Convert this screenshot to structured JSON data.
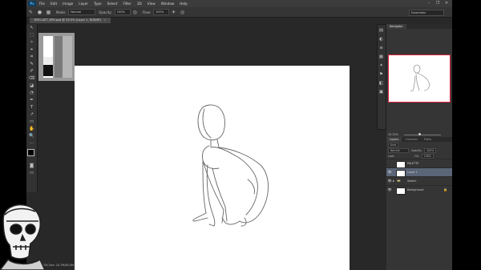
{
  "app": {
    "logo": "Ps",
    "menu": [
      "File",
      "Edit",
      "Image",
      "Layer",
      "Type",
      "Select",
      "Filter",
      "3D",
      "View",
      "Window",
      "Help"
    ],
    "window_controls": {
      "minimize": "–",
      "restore": "❐",
      "close": "✕"
    }
  },
  "options": {
    "mode_label": "Mode:",
    "mode_value": "Normal",
    "opacity_label": "Opacity:",
    "opacity_value": "100%",
    "flow_label": "Flow:",
    "flow_value": "100%",
    "workspace": "Essentials"
  },
  "document": {
    "tab_title": "REF.LAST_4RH.psd @ 33.3% (Layer 1, RGB/8*)",
    "close": "×",
    "status": "33.33%     Doc: 24.7M/48.0M"
  },
  "tools": [
    "↖",
    "⬚",
    "✧",
    "⌖",
    "⌗",
    "✎",
    "✐",
    "⌫",
    "◪",
    "◔",
    "✒",
    "T",
    "↗",
    "▭",
    "✋",
    "🔍",
    "⋯"
  ],
  "dock_icons": [
    "▤",
    "◐",
    "≡",
    "▦",
    "✦",
    "⚑",
    "◧",
    "▣"
  ],
  "panels": {
    "navigator_tab": "Navigator",
    "zoom": "33.33%",
    "layer_tabs": [
      "Layers",
      "Channels",
      "Paths"
    ],
    "kind_label": "Kind",
    "blend": "Normal",
    "opacity_label": "Opacity:",
    "opacity_value": "100%",
    "lock_label": "Lock:",
    "fill_label": "Fill:",
    "fill_value": "100%",
    "layers": [
      {
        "name": "PALETTE",
        "visible": "",
        "selected": false,
        "folder": false,
        "lock": ""
      },
      {
        "name": "Layer 1",
        "visible": "👁",
        "selected": true,
        "folder": false,
        "lock": ""
      },
      {
        "name": "Sketch",
        "visible": "👁",
        "selected": false,
        "folder": true,
        "lock": ""
      },
      {
        "name": "Background",
        "visible": "👁",
        "selected": false,
        "folder": false,
        "lock": "🔒"
      }
    ]
  },
  "colors": {
    "accent": "#e0223a",
    "selection": "#5a6577",
    "ps_blue": "#5ab0e8"
  }
}
